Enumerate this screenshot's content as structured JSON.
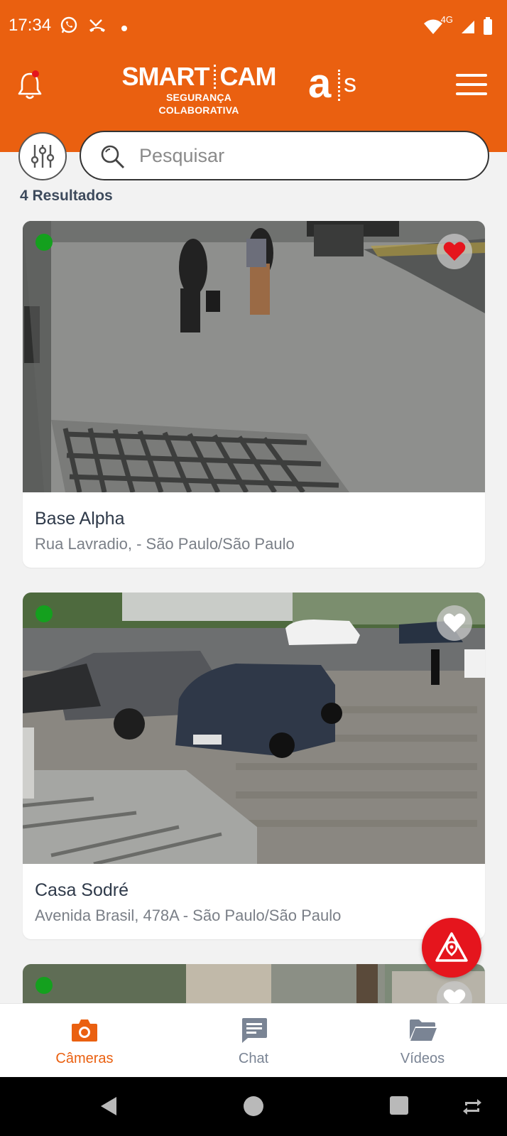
{
  "status_bar": {
    "time": "17:34",
    "network": "4G"
  },
  "header": {
    "logo_title_left": "SMART",
    "logo_title_right": "CAM",
    "logo_subtitle": "SEGURANÇA COLABORATIVA",
    "partner_logo_a": "a",
    "partner_logo_s": "s",
    "colors": {
      "brand": "#ea6010",
      "notification_dot": "#e5151d"
    }
  },
  "search": {
    "placeholder": "Pesquisar"
  },
  "results_label": "4 Resultados",
  "cameras": [
    {
      "title": "Base Alpha",
      "address": "Rua Lavradio,  - São Paulo/São Paulo",
      "online": true,
      "favorite": true
    },
    {
      "title": "Casa Sodré",
      "address": "Avenida Brasil, 478A - São Paulo/São Paulo",
      "online": true,
      "favorite": false
    },
    {
      "title": "",
      "address": "",
      "online": true,
      "favorite": false
    }
  ],
  "sos_button": {
    "icon": "alert-location-icon"
  },
  "bottom_nav": {
    "items": [
      {
        "label": "Câmeras",
        "icon": "camera-icon",
        "active": true
      },
      {
        "label": "Chat",
        "icon": "chat-icon",
        "active": false
      },
      {
        "label": "Vídeos",
        "icon": "folder-icon",
        "active": false
      }
    ],
    "active_color": "#ea6010",
    "inactive_color": "#7a8494"
  }
}
